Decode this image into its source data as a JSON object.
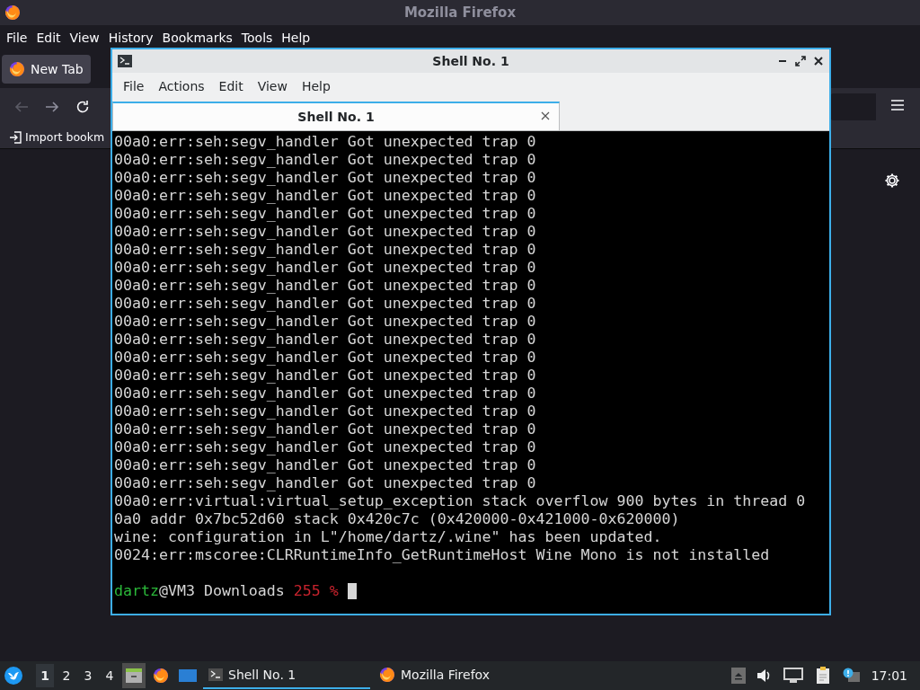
{
  "firefox": {
    "title": "Mozilla Firefox",
    "menu": [
      "File",
      "Edit",
      "View",
      "History",
      "Bookmarks",
      "Tools",
      "Help"
    ],
    "tabs": [
      {
        "label": "New Tab",
        "selected": true
      }
    ],
    "bookmarks": [
      "Import bookm"
    ]
  },
  "terminal": {
    "title": "Shell No. 1",
    "menu": [
      "File",
      "Actions",
      "Edit",
      "View",
      "Help"
    ],
    "tabs": [
      {
        "label": "Shell No. 1",
        "selected": true
      }
    ],
    "lines": [
      "00a0:err:seh:segv_handler Got unexpected trap 0",
      "00a0:err:seh:segv_handler Got unexpected trap 0",
      "00a0:err:seh:segv_handler Got unexpected trap 0",
      "00a0:err:seh:segv_handler Got unexpected trap 0",
      "00a0:err:seh:segv_handler Got unexpected trap 0",
      "00a0:err:seh:segv_handler Got unexpected trap 0",
      "00a0:err:seh:segv_handler Got unexpected trap 0",
      "00a0:err:seh:segv_handler Got unexpected trap 0",
      "00a0:err:seh:segv_handler Got unexpected trap 0",
      "00a0:err:seh:segv_handler Got unexpected trap 0",
      "00a0:err:seh:segv_handler Got unexpected trap 0",
      "00a0:err:seh:segv_handler Got unexpected trap 0",
      "00a0:err:seh:segv_handler Got unexpected trap 0",
      "00a0:err:seh:segv_handler Got unexpected trap 0",
      "00a0:err:seh:segv_handler Got unexpected trap 0",
      "00a0:err:seh:segv_handler Got unexpected trap 0",
      "00a0:err:seh:segv_handler Got unexpected trap 0",
      "00a0:err:seh:segv_handler Got unexpected trap 0",
      "00a0:err:seh:segv_handler Got unexpected trap 0",
      "00a0:err:seh:segv_handler Got unexpected trap 0",
      "00a0:err:virtual:virtual_setup_exception stack overflow 900 bytes in thread 0",
      "0a0 addr 0x7bc52d60 stack 0x420c7c (0x420000-0x421000-0x620000)",
      "wine: configuration in L\"/home/dartz/.wine\" has been updated.",
      "0024:err:mscoree:CLRRuntimeInfo_GetRuntimeHost Wine Mono is not installed"
    ],
    "prompt": {
      "user": "dartz",
      "host_path": "@VM3 Downloads",
      "status": "255 %"
    }
  },
  "taskbar": {
    "workspaces": [
      {
        "label": "1",
        "selected": true
      },
      {
        "label": "2",
        "selected": false
      },
      {
        "label": "3",
        "selected": false
      },
      {
        "label": "4",
        "selected": false
      }
    ],
    "tasks": [
      {
        "label": "Shell No. 1",
        "kind": "terminal",
        "selected": true
      },
      {
        "label": "Mozilla Firefox",
        "kind": "browser",
        "selected": false
      }
    ],
    "clock": "17:01"
  }
}
